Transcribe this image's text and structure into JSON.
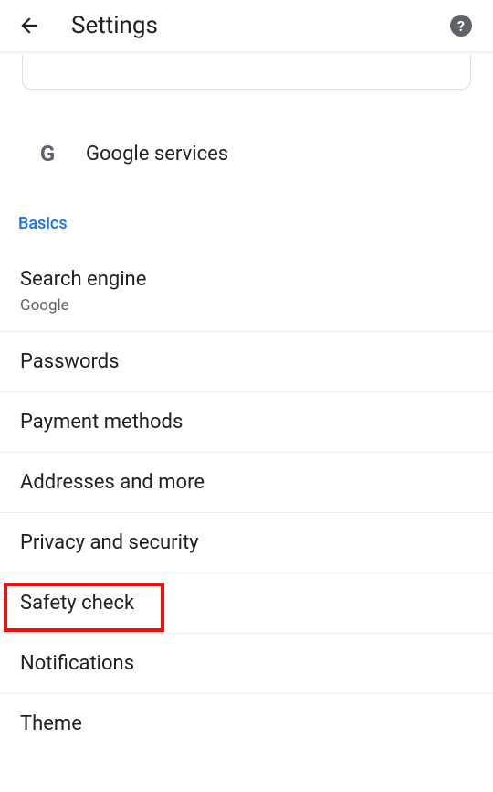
{
  "header": {
    "title": "Settings"
  },
  "google": {
    "glyph": "G",
    "label": "Google services"
  },
  "section": {
    "basics": "Basics"
  },
  "items": {
    "search_engine": {
      "label": "Search engine",
      "sub": "Google"
    },
    "passwords": {
      "label": "Passwords"
    },
    "payment": {
      "label": "Payment methods"
    },
    "addresses": {
      "label": "Addresses and more"
    },
    "privacy": {
      "label": "Privacy and security"
    },
    "safety": {
      "label": "Safety check"
    },
    "notifications": {
      "label": "Notifications"
    },
    "theme": {
      "label": "Theme"
    }
  },
  "help": {
    "glyph": "?"
  }
}
